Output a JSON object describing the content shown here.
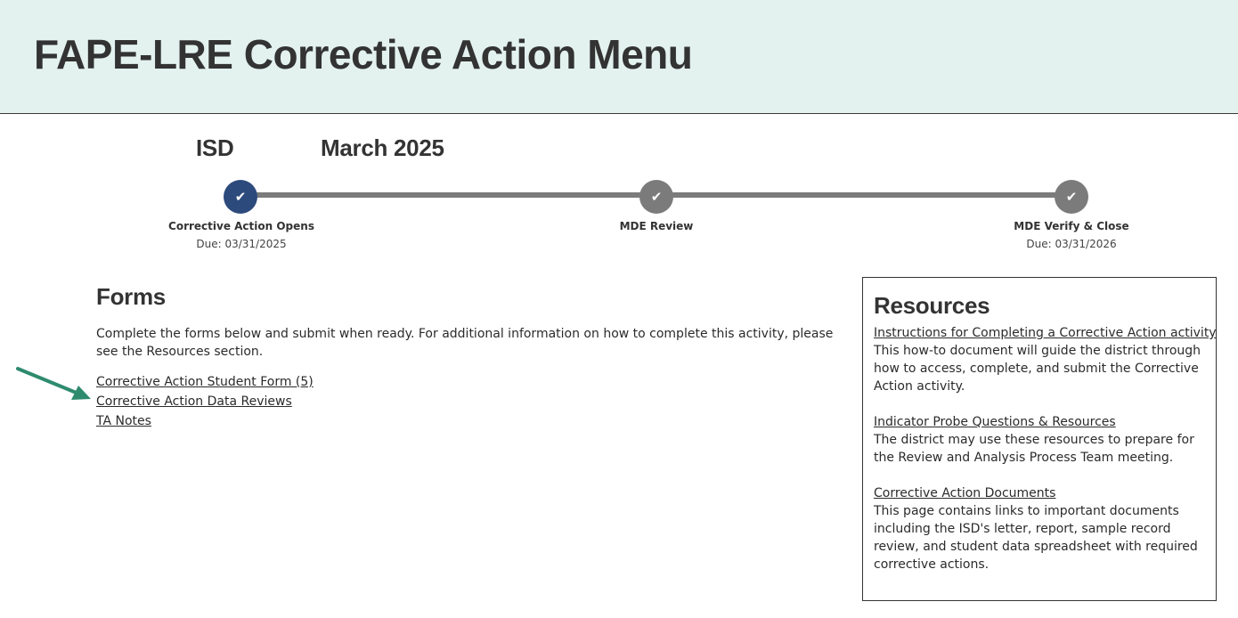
{
  "header": {
    "title": "FAPE-LRE Corrective Action Menu",
    "background": "#e3f2ef"
  },
  "meta": {
    "org": "ISD",
    "period": "March 2025"
  },
  "progress": {
    "accent_active": "#2d4a7c",
    "accent_done": "#7b7b7b",
    "steps": [
      {
        "label": "Corrective Action Opens",
        "due": "Due: 03/31/2025",
        "state": "active",
        "icon": "check-icon"
      },
      {
        "label": "MDE Review",
        "due": "",
        "state": "complete",
        "icon": "check-icon"
      },
      {
        "label": "MDE Verify & Close",
        "due": "Due: 03/31/2026",
        "state": "complete",
        "icon": "check-icon"
      }
    ]
  },
  "forms": {
    "heading": "Forms",
    "description": "Complete the forms below and submit when ready. For additional information on how to complete this activity, please see the Resources section.",
    "links": [
      "Corrective Action Student Form (5)",
      "Corrective Action Data Reviews",
      "TA Notes"
    ],
    "arrow_color": "#2e8b6e"
  },
  "resources": {
    "heading": "Resources",
    "items": [
      {
        "link": "Instructions for Completing a Corrective Action activity",
        "description": "This how-to document will guide the district through how to access, complete, and submit the Corrective Action activity."
      },
      {
        "link": "Indicator Probe Questions & Resources",
        "description": "The district may use these resources to prepare for the Review and Analysis Process Team meeting."
      },
      {
        "link": "Corrective Action Documents",
        "description": "This page contains links to important documents including the ISD's letter, report, sample record review, and student data spreadsheet with required corrective actions."
      }
    ]
  }
}
